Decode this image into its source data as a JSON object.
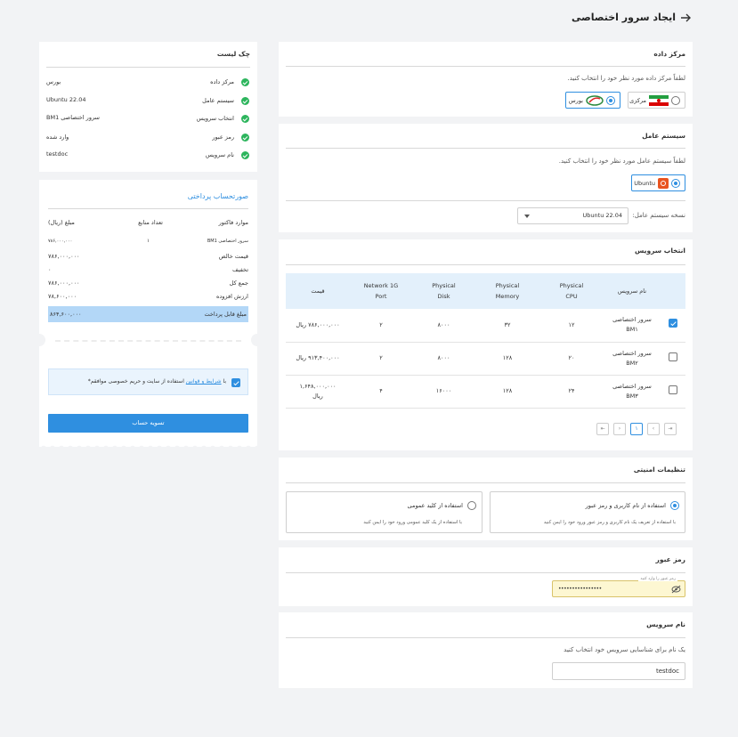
{
  "header": {
    "title": "ایجاد سرور اختصاصی"
  },
  "datacenter": {
    "title": "مرکز داده",
    "prompt": "لطفاً مرکز داده مورد نظر خود را انتخاب کنید.",
    "options": [
      "مرکزی",
      "بورس"
    ],
    "selected": "بورس"
  },
  "os": {
    "title": "سیستم عامل",
    "prompt": "لطفاً سیستم عامل مورد نظر خود را انتخاب کنید.",
    "option": "Ubuntu",
    "version_label": "نسخه سیستم عامل:",
    "version_value": "Ubuntu 22.04"
  },
  "service": {
    "title": "انتخاب سرویس",
    "headers": {
      "name": "نام سرویس",
      "cpu_1": "Physical",
      "cpu_2": "CPU",
      "mem_1": "Physical",
      "mem_2": "Memory",
      "disk_1": "Physical",
      "disk_2": "Disk",
      "port_1": "Network 1G",
      "port_2": "Port",
      "price": "قیمت"
    },
    "rows": [
      {
        "name_1": "سرور اختصاصی",
        "name_2": "BM۱",
        "cpu": "۱۲",
        "mem": "۳۲",
        "disk": "۸۰۰۰",
        "port": "۲",
        "price_1": "۷۸۶,۰۰۰,۰۰۰ ریال",
        "price_2": "",
        "checked": true
      },
      {
        "name_1": "سرور اختصاصی",
        "name_2": "BM۲",
        "cpu": "۲۰",
        "mem": "۱۲۸",
        "disk": "۸۰۰۰",
        "port": "۲",
        "price_1": "۹۱۳,۴۰۰,۰۰۰ ریال",
        "price_2": "",
        "checked": false
      },
      {
        "name_1": "سرور اختصاصی",
        "name_2": "BM۳",
        "cpu": "۲۴",
        "mem": "۱۲۸",
        "disk": "۱۶۰۰۰",
        "port": "۴",
        "price_1": "۱,۶۴۸,۰۰۰,۰۰۰",
        "price_2": "ریال",
        "checked": false
      }
    ],
    "pagination": {
      "current": "۱"
    }
  },
  "security": {
    "title": "تنظیمات امنیتی",
    "opt1_title": "استفاده از نام کاربری و رمز عبور",
    "opt1_desc": "با استفاده از تعریف یک نام کاربری و رمز عبور ورود خود را ایمن کنید",
    "opt2_title": "استفاده از کلید عمومی",
    "opt2_desc": "با استفاده از یک کلید عمومی ورود خود را ایمن کنید"
  },
  "password": {
    "title": "رمز عبور",
    "field_label": "رمز عبور را وارد کنید",
    "value": "••••••••••••••••"
  },
  "service_name": {
    "title": "نام سرویس",
    "prompt": "یک نام برای شناسایی سرویس خود انتخاب کنید",
    "value": "testdoc"
  },
  "checklist": {
    "title": "چک لیست",
    "items": [
      {
        "label": "مرکز داده",
        "value": "بورس"
      },
      {
        "label": "سیستم عامل",
        "value": "Ubuntu 22.04"
      },
      {
        "label": "انتخاب سرویس",
        "value": "سرور اختصاصی BM1"
      },
      {
        "label": "رمز عبور",
        "value": "وارد شده"
      },
      {
        "label": "نام سرویس",
        "value": "testdoc"
      }
    ]
  },
  "invoice": {
    "title": "صورتحساب پرداختی",
    "col_items": "موارد فاکتور",
    "col_count": "تعداد منابع",
    "col_amount": "مبلغ (ریال)",
    "line_item": "سرور اختصاصی BM1",
    "line_count": "۱",
    "line_amount": "۷۸۶,۰۰۰,۰۰۰",
    "rows": [
      {
        "label": "قیمت خالص",
        "value": "۷۸۶,۰۰۰,۰۰۰"
      },
      {
        "label": "تخفیف",
        "value": "۰"
      },
      {
        "label": "جمع کل",
        "value": "۷۸۶,۰۰۰,۰۰۰"
      },
      {
        "label": "ارزش افزوده",
        "value": "۷۸,۶۰۰,۰۰۰"
      }
    ],
    "total_label": "مبلغ قابل پرداخت",
    "total_value": "۸۶۴,۶۰۰,۰۰۰",
    "terms_pre": "با",
    "terms_link": "شرایط و قوانین",
    "terms_post": "استفاده از سایت و حریم خصوصی موافقم*",
    "pay_button": "تسویه حساب"
  },
  "colors": {
    "accent": "#2f8fe0",
    "success": "#2db55d",
    "total_bg": "#b3d7f7",
    "password_bg": "#fdf7d2"
  }
}
